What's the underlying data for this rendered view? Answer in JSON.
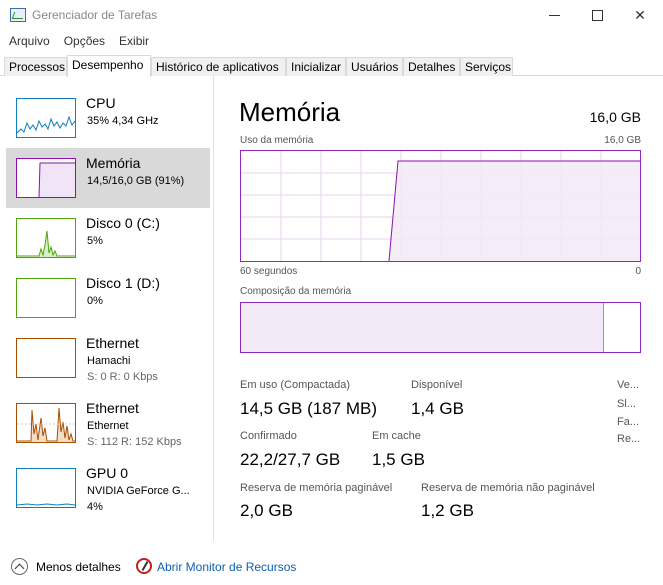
{
  "window": {
    "title": "Gerenciador de Tarefas"
  },
  "menu": [
    "Arquivo",
    "Opções",
    "Exibir"
  ],
  "tabs": [
    "Processos",
    "Desempenho",
    "Histórico de aplicativos",
    "Inicializar",
    "Usuários",
    "Detalhes",
    "Serviços"
  ],
  "active_tab": "Desempenho",
  "sidebar": [
    {
      "title": "CPU",
      "sub1": "35%  4,34 GHz",
      "sub2": "",
      "color": "#117dbb"
    },
    {
      "title": "Memória",
      "sub1": "14,5/16,0 GB (91%)",
      "sub2": "",
      "color": "#8b12ae"
    },
    {
      "title": "Disco 0 (C:)",
      "sub1": "5%",
      "sub2": "",
      "color": "#4da60c"
    },
    {
      "title": "Disco 1 (D:)",
      "sub1": "0%",
      "sub2": "",
      "color": "#4da60c"
    },
    {
      "title": "Ethernet",
      "sub1": "Hamachi",
      "sub2": "S: 0  R: 0 Kbps",
      "color": "#a74f01"
    },
    {
      "title": "Ethernet",
      "sub1": "Ethernet",
      "sub2": "S: 112  R: 152 Kbps",
      "color": "#a74f01"
    },
    {
      "title": "GPU 0",
      "sub1": "NVIDIA GeForce G...",
      "sub2": "4%",
      "color": "#117dbb"
    }
  ],
  "main": {
    "title": "Memória",
    "total": "16,0 GB",
    "usage_label": "Uso da memória",
    "usage_max": "16,0 GB",
    "time_left": "60 segundos",
    "time_right": "0",
    "composition_label": "Composição da memória",
    "usage_fraction": 0.91,
    "stats": {
      "in_use_label": "Em uso (Compactada)",
      "in_use_value": "14,5 GB (187 MB)",
      "available_label": "Disponível",
      "available_value": "1,4 GB",
      "committed_label": "Confirmado",
      "committed_value": "22,2/27,7 GB",
      "cached_label": "Em cache",
      "cached_value": "1,5 GB",
      "paged_label": "Reserva de memória paginável",
      "paged_value": "2,0 GB",
      "nonpaged_label": "Reserva de memória não paginável",
      "nonpaged_value": "1,2 GB",
      "right_labels": [
        "Ve...",
        "Sl...",
        "Fa...",
        "Re..."
      ]
    }
  },
  "footer": {
    "less_details": "Menos detalhes",
    "resmon": "Abrir Monitor de Recursos"
  }
}
